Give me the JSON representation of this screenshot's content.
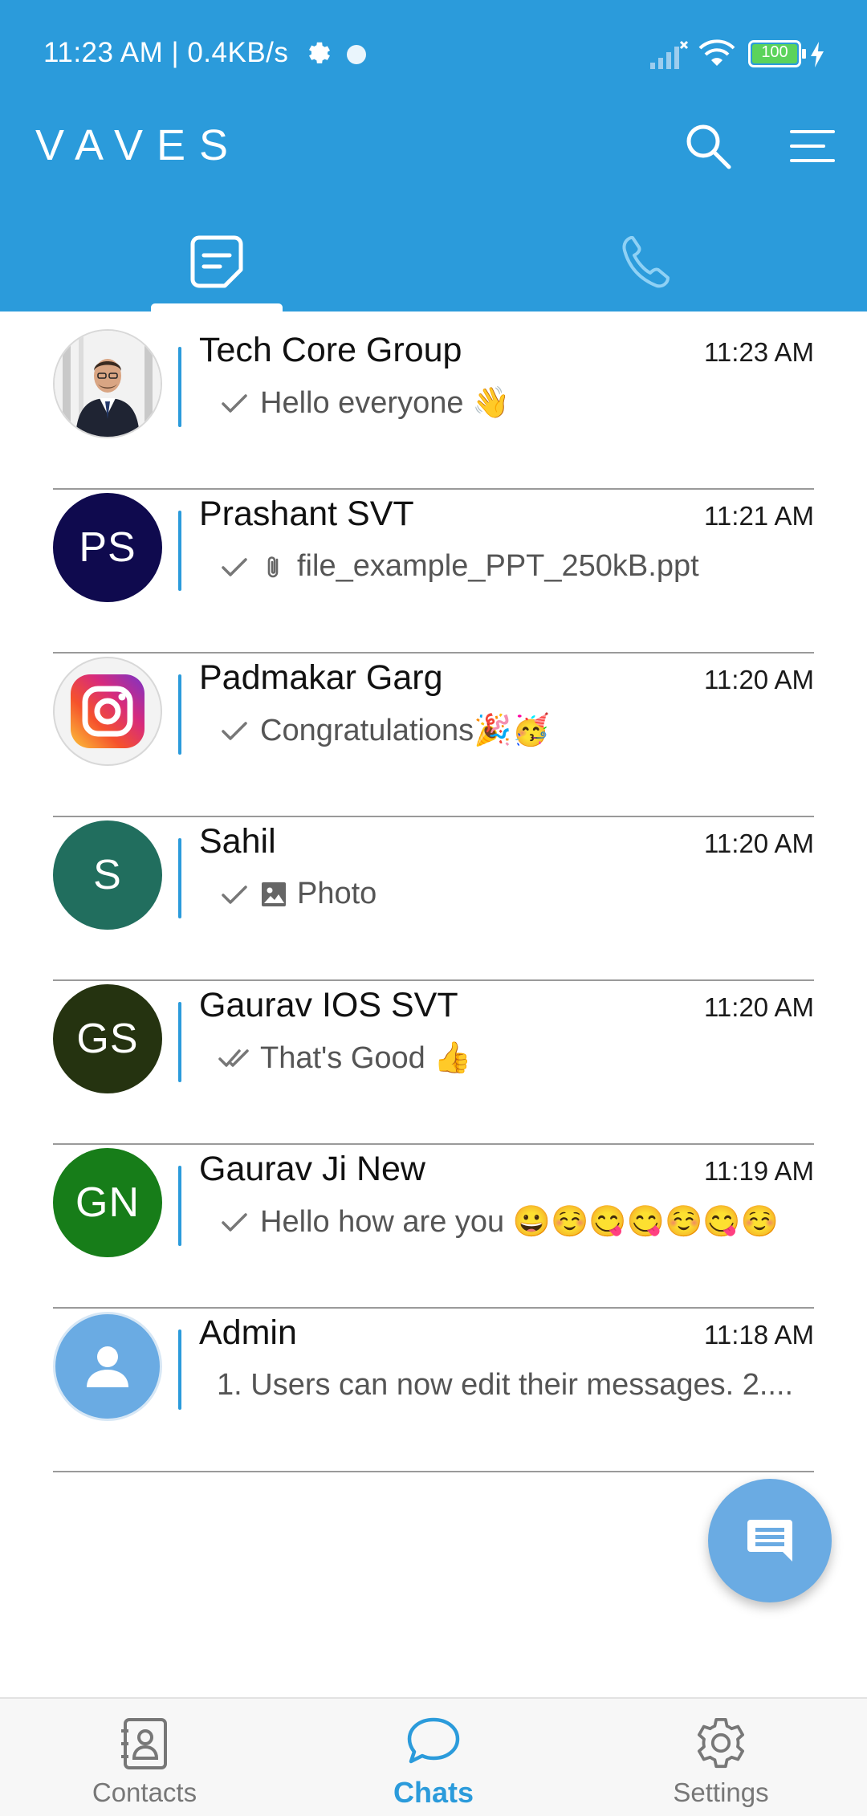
{
  "status_bar": {
    "time_and_speed": "11:23 AM | 0.4KB/s",
    "battery_level": "100"
  },
  "header": {
    "app_title": "VAVES",
    "search_icon": "search-icon",
    "menu_icon": "menu-icon",
    "tabs": [
      {
        "name": "chats",
        "icon": "chat-tab-icon",
        "active": true
      },
      {
        "name": "calls",
        "icon": "phone-icon",
        "active": false
      }
    ]
  },
  "chats": [
    {
      "name": "Tech Core Group",
      "time": "11:23 AM",
      "preview": "Hello everyone 👋",
      "tick": "single",
      "avatar_type": "photo"
    },
    {
      "name": "Prashant SVT",
      "time": "11:21 AM",
      "preview": "file_example_PPT_250kB.ppt",
      "tick": "single",
      "attachment": "paperclip-icon",
      "avatar_initials": "PS",
      "avatar_color": "#0f0a4e"
    },
    {
      "name": "Padmakar Garg",
      "time": "11:20 AM",
      "preview": "Congratulations🎉🥳",
      "tick": "single",
      "avatar_type": "instagram-logo"
    },
    {
      "name": "Sahil",
      "time": "11:20 AM",
      "preview": "Photo",
      "tick": "single",
      "attachment": "image-icon",
      "avatar_initials": "S",
      "avatar_color": "#216e5e"
    },
    {
      "name": "Gaurav IOS SVT",
      "time": "11:20 AM",
      "preview": "That's Good 👍",
      "tick": "double",
      "avatar_initials": "GS",
      "avatar_color": "#253310"
    },
    {
      "name": "Gaurav Ji New",
      "time": "11:19 AM",
      "preview": "Hello how are you 😀☺️😋😋☺️😋☺️",
      "tick": "single",
      "avatar_initials": "GN",
      "avatar_color": "#177d19"
    },
    {
      "name": "Admin",
      "time": "11:18 AM",
      "preview": "1. Users can now edit their messages. 2....",
      "tick": "none",
      "avatar_type": "person-icon",
      "avatar_color": "#6aabe3"
    }
  ],
  "fab": {
    "icon": "new-message-icon",
    "color": "#6aabe3"
  },
  "bottom_nav": [
    {
      "label": "Contacts",
      "icon": "contacts-icon",
      "active": false
    },
    {
      "label": "Chats",
      "icon": "chat-bubble-icon",
      "active": true
    },
    {
      "label": "Settings",
      "icon": "settings-gear-icon",
      "active": false
    }
  ],
  "colors": {
    "primary": "#2b9bdb",
    "divider": "#9a9a9a"
  }
}
